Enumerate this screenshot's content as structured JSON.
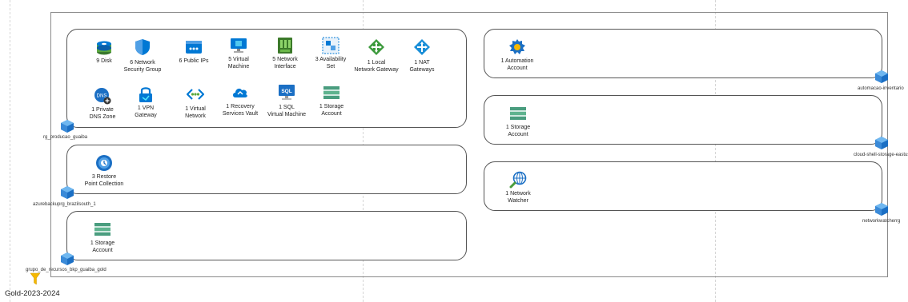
{
  "subscription_label": "Gold-2023-2024",
  "groups": [
    {
      "name": "rg_producao_guaiba",
      "items": [
        {
          "icon": "disk-icon",
          "line1": "9 Disk",
          "line2": ""
        },
        {
          "icon": "network-security-group-icon",
          "line1": "6 Network",
          "line2": "Security Group"
        },
        {
          "icon": "public-ip-icon",
          "line1": "6 Public IPs",
          "line2": ""
        },
        {
          "icon": "virtual-machine-icon",
          "line1": "5 Virtual",
          "line2": "Machine"
        },
        {
          "icon": "network-interface-icon",
          "line1": "5 Network",
          "line2": "Interface"
        },
        {
          "icon": "availability-set-icon",
          "line1": "3 Availability",
          "line2": "Set"
        },
        {
          "icon": "local-network-gateway-icon",
          "line1": "1 Local",
          "line2": "Network Gateway"
        },
        {
          "icon": "nat-gateway-icon",
          "line1": "1 NAT",
          "line2": "Gateways"
        },
        {
          "icon": "private-dns-zone-icon",
          "line1": "1 Private",
          "line2": "DNS Zone"
        },
        {
          "icon": "vpn-gateway-icon",
          "line1": "1 VPN",
          "line2": "Gateway"
        },
        {
          "icon": "virtual-network-icon",
          "line1": "1 Virtual",
          "line2": "Network"
        },
        {
          "icon": "recovery-services-vault-icon",
          "line1": "1 Recovery",
          "line2": "Services Vault"
        },
        {
          "icon": "sql-virtual-machine-icon",
          "line1": "1 SQL",
          "line2": "Virtual Machine"
        },
        {
          "icon": "storage-account-icon",
          "line1": "1 Storage",
          "line2": "Account"
        }
      ]
    },
    {
      "name": "azurebackuprg_brazilsouth_1",
      "items": [
        {
          "icon": "restore-point-collection-icon",
          "line1": "3 Restore",
          "line2": "Point Collection"
        }
      ]
    },
    {
      "name": "grupo_de_recursos_bkp_guaiba_gold",
      "items": [
        {
          "icon": "storage-account-icon",
          "line1": "1 Storage",
          "line2": "Account"
        }
      ]
    },
    {
      "name": "automacao-inventario",
      "items": [
        {
          "icon": "automation-account-icon",
          "line1": "1 Automation",
          "line2": "Account"
        }
      ]
    },
    {
      "name": "cloud-shell-storage-eastus",
      "items": [
        {
          "icon": "storage-account-icon",
          "line1": "1 Storage",
          "line2": "Account"
        }
      ]
    },
    {
      "name": "networkwatcherrg",
      "items": [
        {
          "icon": "network-watcher-icon",
          "line1": "1 Network",
          "line2": "Watcher"
        }
      ]
    }
  ],
  "colors": {
    "azure_blue": "#0078d4",
    "storage_green": "#4a9d7f",
    "funnel_gold": "#f5b800"
  }
}
